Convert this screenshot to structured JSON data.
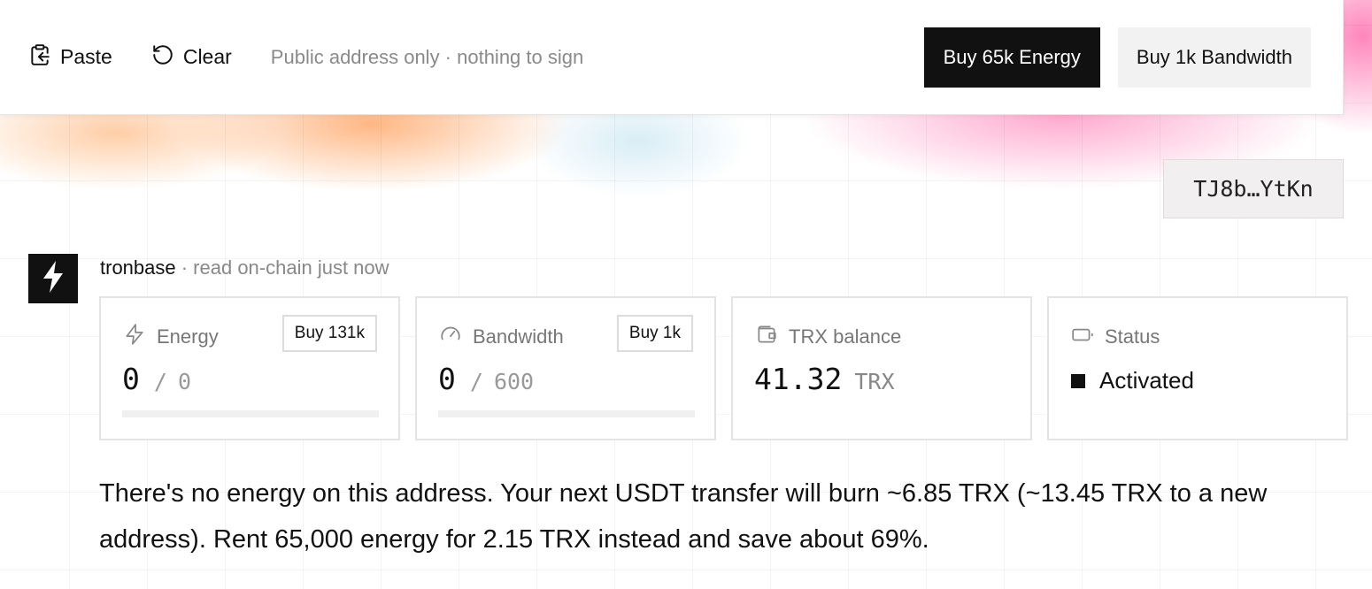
{
  "toolbar": {
    "paste_label": "Paste",
    "clear_label": "Clear",
    "hint": "Public address only · nothing to sign",
    "buy_energy_label": "Buy 65k Energy",
    "buy_bandwidth_label": "Buy 1k Bandwidth"
  },
  "address": "TJ8b…YtKn",
  "brand": {
    "name": "tronbase",
    "subtitle": " · read on-chain just now"
  },
  "cards": {
    "energy": {
      "label": "Energy",
      "button": "Buy 131k",
      "used": "0",
      "separator": "/",
      "total": "0",
      "fill": 0
    },
    "bandwidth": {
      "label": "Bandwidth",
      "button": "Buy 1k",
      "used": "0",
      "separator": "/",
      "total": "600",
      "fill": 0
    },
    "trx": {
      "label": "TRX balance",
      "value": "41.32",
      "unit": "TRX"
    },
    "status": {
      "label": "Status",
      "value": "Activated"
    }
  },
  "message": "There's no energy on this address. Your next USDT transfer will burn ~6.85 TRX (~13.45 TRX to a new address). Rent 65,000 energy for 2.15 TRX instead and save about 69%.",
  "icons": {
    "paste": "clipboard-icon",
    "clear": "rotate-ccw-icon",
    "brand": "bolt-icon",
    "energy": "zap-icon",
    "bandwidth": "gauge-icon",
    "trx": "wallet-icon",
    "status": "battery-icon"
  },
  "colors": {
    "accent_dark": "#111111",
    "muted": "#888888"
  }
}
